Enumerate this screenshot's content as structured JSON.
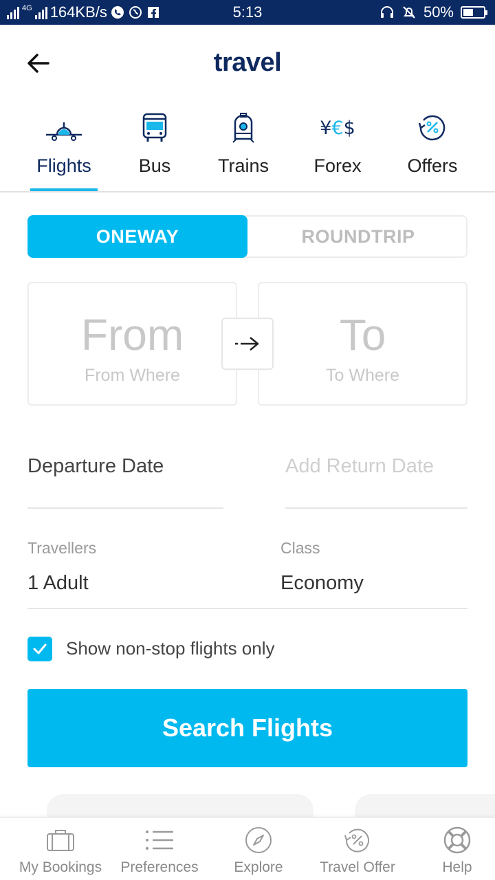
{
  "status_bar": {
    "network_type": "4G",
    "speed": "164KB/s",
    "time": "5:13",
    "battery": "50%",
    "battery_level": 0.5
  },
  "header": {
    "back_icon": "arrow-left-icon",
    "logo": "travel"
  },
  "categories": [
    {
      "label": "Flights",
      "icon": "airplane-icon",
      "active": true
    },
    {
      "label": "Bus",
      "icon": "bus-icon",
      "active": false
    },
    {
      "label": "Trains",
      "icon": "train-icon",
      "active": false
    },
    {
      "label": "Forex",
      "icon": "currency-icon",
      "active": false
    },
    {
      "label": "Offers",
      "icon": "offers-icon",
      "active": false
    }
  ],
  "trip_type": {
    "oneway": "ONEWAY",
    "roundtrip": "ROUNDTRIP",
    "selected": "ONEWAY"
  },
  "from": {
    "title": "From",
    "subtitle": "From Where"
  },
  "to": {
    "title": "To",
    "subtitle": "To Where"
  },
  "dates": {
    "departure": "Departure Date",
    "return": "Add Return Date"
  },
  "travellers": {
    "label": "Travellers",
    "value": "1 Adult"
  },
  "travel_class": {
    "label": "Class",
    "value": "Economy"
  },
  "non_stop": {
    "label": "Show non-stop flights only",
    "checked": true
  },
  "search_button": "Search Flights",
  "bottom_nav": [
    {
      "label": "My Bookings",
      "icon": "briefcase-icon"
    },
    {
      "label": "Preferences",
      "icon": "list-icon"
    },
    {
      "label": "Explore",
      "icon": "compass-icon"
    },
    {
      "label": "Travel Offer",
      "icon": "offers-icon"
    },
    {
      "label": "Help",
      "icon": "lifebuoy-icon"
    }
  ],
  "colors": {
    "accent": "#00b9ef",
    "brand": "#0f2a5f",
    "status_bar": "#0b2a63"
  }
}
